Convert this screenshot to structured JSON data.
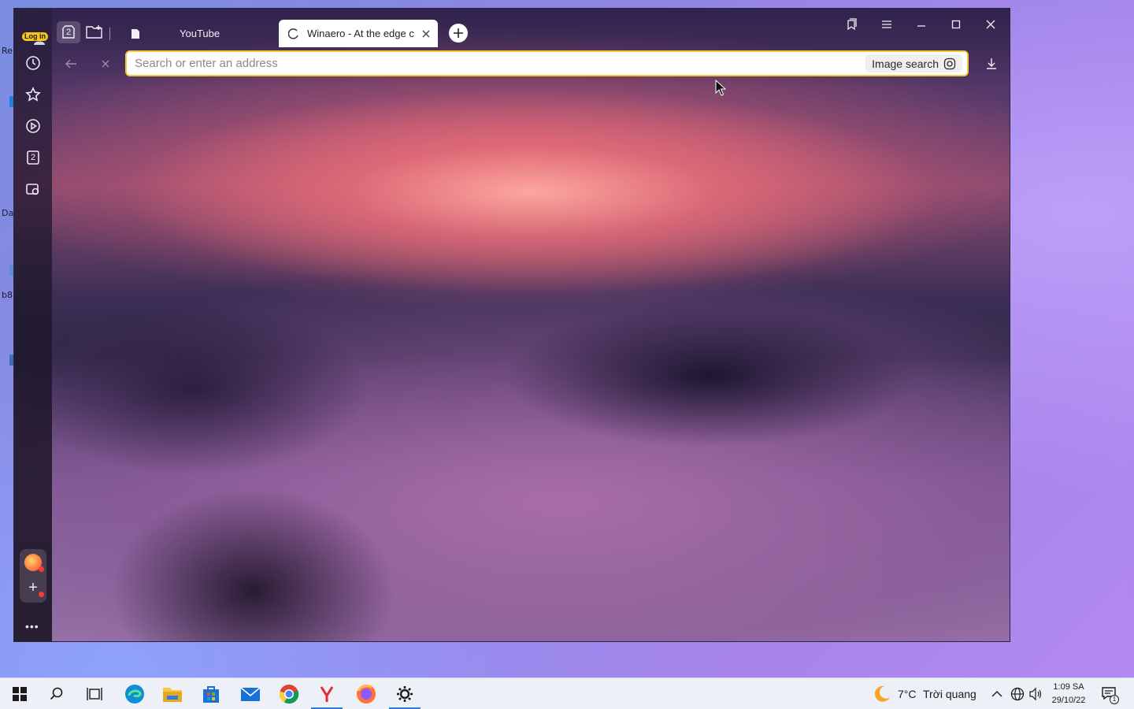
{
  "desktop": {
    "fragments": [
      "Re",
      "Da",
      "b8"
    ]
  },
  "browser": {
    "sidebar": {
      "login_label": "Log in",
      "tabs_counter": "2",
      "more_label": "•••"
    },
    "tab_group_count": "2",
    "tabs": [
      {
        "title": "YouTube",
        "active": false
      },
      {
        "title": "Winaero - At the edge c",
        "active": true
      }
    ],
    "omnibox": {
      "placeholder": "Search or enter an address",
      "value": "",
      "image_search_label": "Image search"
    }
  },
  "taskbar": {
    "weather_temp": "7°C",
    "weather_text": "Trời quang",
    "clock_time": "1:09 SA",
    "clock_date": "29/10/22",
    "notification_count": "1"
  },
  "colors": {
    "omnibox_border": "#f6c73b",
    "taskbar_active": "#2f7de1",
    "badge": "#f5c518"
  }
}
